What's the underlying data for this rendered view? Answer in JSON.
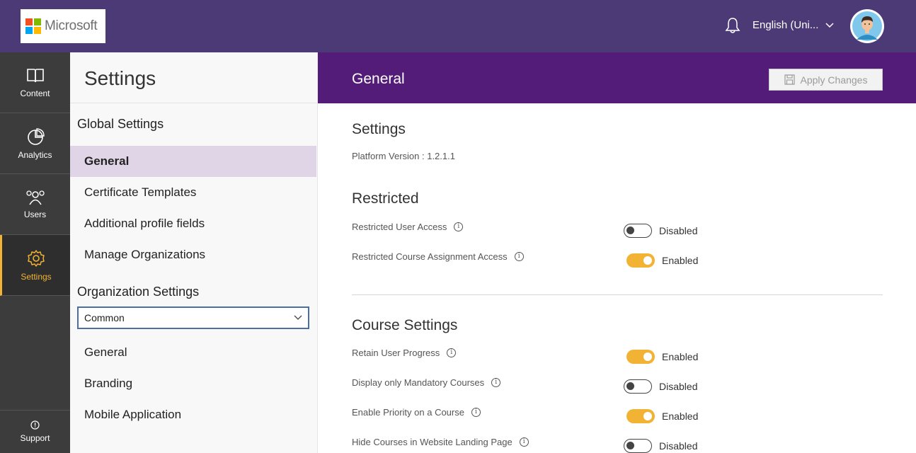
{
  "brand": {
    "name": "Microsoft"
  },
  "topbar": {
    "language": "English (Uni..."
  },
  "leftnav": [
    {
      "label": "Content"
    },
    {
      "label": "Analytics"
    },
    {
      "label": "Users"
    },
    {
      "label": "Settings"
    }
  ],
  "support": {
    "label": "Support"
  },
  "settings_column": {
    "title": "Settings",
    "global_heading": "Global Settings",
    "global_items": [
      "General",
      "Certificate Templates",
      "Additional profile fields",
      "Manage Organizations"
    ],
    "org_heading": "Organization Settings",
    "org_select_value": "Common",
    "org_items": [
      "General",
      "Branding",
      "Mobile Application"
    ]
  },
  "main": {
    "header_title": "General",
    "apply_button": "Apply Changes",
    "settings_heading": "Settings",
    "platform_version": "Platform Version : 1.2.1.1",
    "restricted_heading": "Restricted",
    "restricted_rows": [
      {
        "label": "Restricted User Access",
        "state": "Disabled",
        "on": false
      },
      {
        "label": "Restricted Course Assignment Access",
        "state": "Enabled",
        "on": true
      }
    ],
    "course_heading": "Course Settings",
    "course_rows": [
      {
        "label": "Retain User Progress",
        "state": "Enabled",
        "on": true
      },
      {
        "label": "Display only Mandatory Courses",
        "state": "Disabled",
        "on": false
      },
      {
        "label": "Enable Priority on a Course",
        "state": "Enabled",
        "on": true
      },
      {
        "label": "Hide Courses in Website Landing Page",
        "state": "Disabled",
        "on": false
      }
    ]
  },
  "colors": {
    "topbar": "#4b3a75",
    "header": "#541c79",
    "accent": "#f2b233",
    "selected": "#e0d5e6"
  }
}
